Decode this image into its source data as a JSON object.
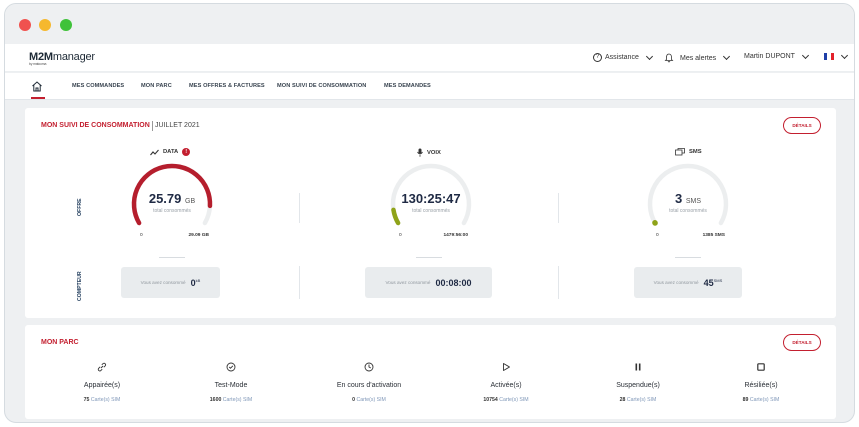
{
  "app": {
    "logo_main": "M2M",
    "logo_rest": "manager",
    "logo_sub": "by matooma"
  },
  "topbar": {
    "assistance": "Assistance",
    "alerts": "Mes alertes",
    "user": "Martin DUPONT"
  },
  "nav": {
    "items": [
      "MES COMMANDES",
      "MON PARC",
      "MES OFFRES & FACTURES",
      "MON SUIVI DE CONSOMMATION",
      "MES DEMANDES"
    ]
  },
  "consumption": {
    "title": "MON SUIVI DE CONSOMMATION",
    "period": "JUILLET 2021",
    "details_label": "DÉTAILS",
    "offer_label": "OFFRE",
    "counter_label": "COMPTEUR",
    "counter_text": "Vous avez consommé",
    "caption": "total consommés",
    "metrics": [
      {
        "name": "DATA",
        "alert": "!",
        "value": "25.79",
        "unit": "GB",
        "min": "0",
        "max": "29.09 GB",
        "fraction": 0.887,
        "color": "#b51e2d",
        "counter_value": "0",
        "counter_unit": "kB"
      },
      {
        "name": "VOIX",
        "value": "130:25:47",
        "unit": "",
        "min": "0",
        "max": "1479:56:00",
        "fraction": 0.088,
        "color": "#8fa319",
        "counter_value": "00:08:00",
        "counter_unit": ""
      },
      {
        "name": "SMS",
        "value": "3",
        "unit": "SMS",
        "min": "0",
        "max": "1385 SMS",
        "fraction": 0.002,
        "color": "#8fa319",
        "counter_value": "45",
        "counter_unit": "SMS"
      }
    ]
  },
  "parc": {
    "title": "MON PARC",
    "details_label": "DÉTAILS",
    "unit_label": "Carte(s) SIM",
    "items": [
      {
        "icon": "link-icon",
        "name": "Appairée(s)",
        "count": "75"
      },
      {
        "icon": "check-circle-icon",
        "name": "Test-Mode",
        "count": "1600"
      },
      {
        "icon": "clock-icon",
        "name": "En cours d'activation",
        "count": "0"
      },
      {
        "icon": "play-icon",
        "name": "Activée(s)",
        "count": "10754"
      },
      {
        "icon": "pause-icon",
        "name": "Suspendue(s)",
        "count": "28"
      },
      {
        "icon": "stop-icon",
        "name": "Résiliée(s)",
        "count": "89"
      }
    ]
  },
  "colors": {
    "accent": "#c31f2f",
    "gauge_track": "#eceeef",
    "navy": "#1f2a44"
  }
}
